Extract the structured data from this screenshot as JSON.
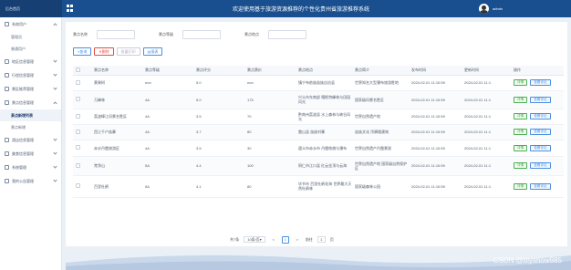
{
  "topbar": {
    "brand": "后台首页",
    "title": "欢迎使用基于旅游资源推荐的个性化贵州省旅游推荐系统",
    "username": "admin"
  },
  "sidebar": {
    "items": [
      {
        "label": "系统用户",
        "open": true,
        "subs": [
          "管理员",
          "普通用户"
        ]
      },
      {
        "label": "地区信息管理"
      },
      {
        "label": "行程信息管理"
      },
      {
        "label": "景区推荐管理"
      },
      {
        "label": "景点信息管理",
        "open": true,
        "subs": [
          "景点新增列表",
          "景点新增"
        ]
      },
      {
        "label": "酒店信息管理"
      },
      {
        "label": "美食信息管理"
      },
      {
        "label": "系统管理"
      },
      {
        "label": "我的公告管理"
      }
    ]
  },
  "search": {
    "name_label": "景点名称",
    "level_label": "景点等级",
    "place_label": "景点地点"
  },
  "buttons": {
    "search": "查询",
    "delete": "删除",
    "bulk": "批量打印",
    "report": "报表"
  },
  "table": {
    "headers": [
      "景点名称",
      "景点等级",
      "景点评分",
      "景点票价",
      "景点地点",
      "景点简介",
      "发布时间",
      "更新时间",
      "操作"
    ],
    "rows": [
      [
        "黄果树",
        "non",
        "5.0",
        "non",
        "镇宁布依族苗族自治县",
        "世界知名大型瀑布旅游胜地",
        "2024-02-01 11:10:59",
        "2024-02-01 11:1"
      ],
      [
        "万峰林",
        "4A",
        "5.0",
        "175",
        "兴义市东南部 喀斯特峰林与田园风光",
        "国家级风景名胜区",
        "2024-02-01 11:10:59",
        "2024-02-01 11:1"
      ],
      [
        "荔波樟江风景名胜区",
        "4A",
        "3.5",
        "70",
        "黔南州荔波县 水上森林与峡谷风光",
        "世界自然遗产地",
        "2024-02-01 11:10:59",
        "2024-02-01 11:1"
      ],
      [
        "西江千户苗寨",
        "4A",
        "3.7",
        "80",
        "雷山县 苗族村寨",
        "苗族文化 吊脚楼建筑",
        "2024-02-01 11:10:59",
        "2024-02-01 11:1"
      ],
      [
        "赤水丹霞旅游区",
        "4A",
        "3.5",
        "30",
        "遵义市赤水市 丹霞地貌与瀑布",
        "世界自然遗产丹霞景观",
        "2024-02-01 11:10:59",
        "2024-02-01 11:1"
      ],
      [
        "梵净山",
        "5A",
        "4.4",
        "100",
        "铜仁市江口县 红云金顶与云海",
        "世界自然遗产地 国家级自然保护区",
        "2024-02-01 11:10:59",
        "2024-02-01 11:1"
      ],
      [
        "百里杜鹃",
        "5A",
        "4.1",
        "80",
        "毕节市 百里杜鹃花海 世界最大天然杜鹃林",
        "国家级森林公园",
        "2024-02-01 11:10:59",
        "2024-02-01 11:1"
      ]
    ],
    "view_label": "详情",
    "rate_label": "查看评论"
  },
  "pager": {
    "total": "共7条",
    "page_size": "10条/页",
    "prev": "<",
    "current": "1",
    "next": ">",
    "goto": "前往",
    "goto_value": "1",
    "page_unit": "页"
  },
  "watermark": "CSDN @biyshow985"
}
